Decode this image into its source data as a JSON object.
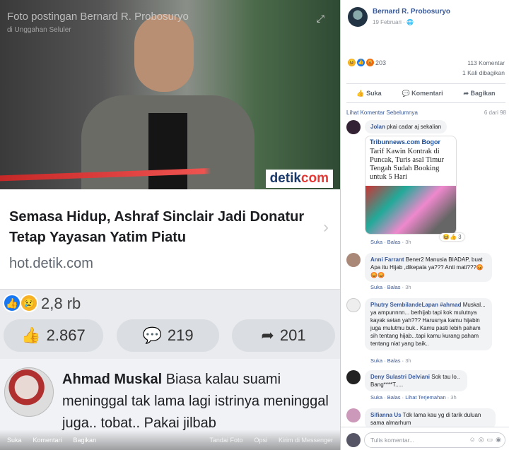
{
  "photo": {
    "caption": "Foto postingan Bernard R. Probosuryo",
    "sub_caption": "di Unggahan Seluler",
    "brand_main": "detik",
    "brand_accent": "com",
    "article_title": "Semasa Hidup, Ashraf Sinclair Jadi Donatur Tetap Yayasan Yatim Piatu",
    "article_domain": "hot.detik.com",
    "reaction_count": "2,8 rb",
    "like_count": "2.867",
    "comment_count": "219",
    "share_count": "201",
    "big_comment_name": "Ahmad Muskal",
    "big_comment_text": "Biasa kalau suami meninggal tak lama lagi istrinya meninggal juga.. tobat.. Pakai jilbab",
    "bottom_bar": {
      "like": "Suka",
      "comment": "Komentari",
      "share": "Bagikan",
      "tag": "Tandai Foto",
      "options": "Opsi",
      "send": "Kirim di Messenger"
    }
  },
  "side": {
    "author": "Bernard R. Probosuryo",
    "date": "19 Februari",
    "reactions": "203",
    "comments_stat": "113 Komentar",
    "shares_stat": "1 Kali dibagikan",
    "action_like": "Suka",
    "action_comment": "Komentari",
    "action_share": "Bagikan",
    "prev_comments": "Lihat Komentar Sebelumnya",
    "prev_count": "6 dari 98",
    "comments": [
      {
        "name": "Jolan",
        "text": "pkai cadar aj sekalian"
      },
      {
        "name": "Anni Farrant",
        "text": "Bener2 Manusia BIADAP, buat Apa itu Hijab ,dikepala ya??? Anti mati???😡😡😡",
        "time": "3h"
      },
      {
        "name": "Phutry SembilandeLapan",
        "tag": "#ahmad",
        "text": "Muskal... ya ampunnnn... berhijab tapi kok mulutnya kayak setan yah??? Harusnya kamu hijabin juga mulutmu buk.. Kamu pasti lebih paham sih tentang hijab...tapi kamu kurang paham tentang niat yang baik..",
        "time": "3h"
      },
      {
        "name": "Deny Sulastri Delviani",
        "text": "Sok tau lo.. Bang****T.....",
        "time": "3h",
        "extra": "Lihat Terjemahan"
      },
      {
        "name": "Sifianna Us",
        "text": "Tdk lama kau yg di tarik duluan sama almarhum"
      }
    ],
    "news_logo": "Tribunnews.com Bogor",
    "news_headline": "Tarif Kawin Kontrak di Puncak, Turis asal Timur Tengah Sudah Booking untuk 5 Hari",
    "news_reactions": "3",
    "news_time": "3h",
    "act_like": "Suka",
    "act_reply": "Balas",
    "write_placeholder": "Tulis komentar..."
  }
}
